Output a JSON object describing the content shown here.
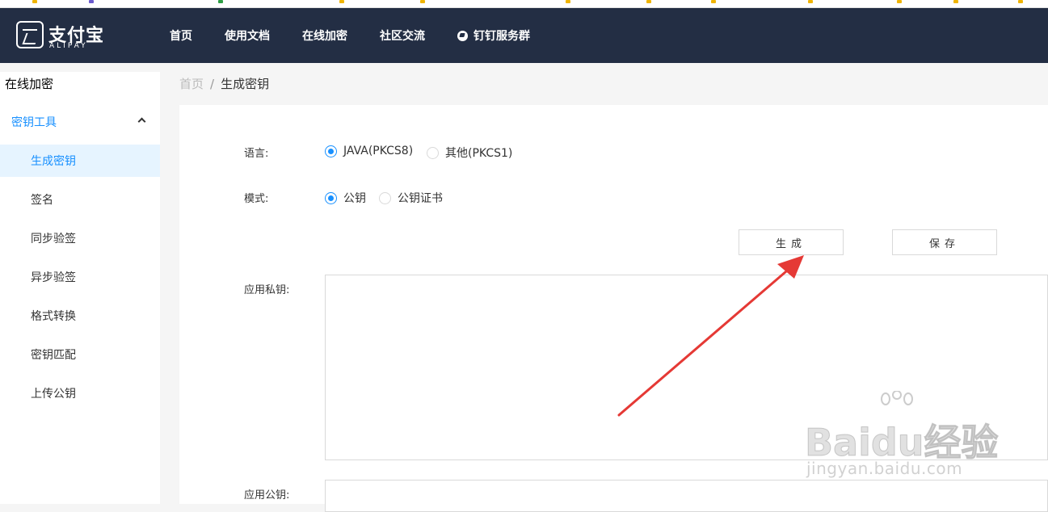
{
  "brand": {
    "name_cn": "支付宝",
    "name_en": "ALIPAY"
  },
  "nav": [
    "首页",
    "使用文档",
    "在线加密",
    "社区交流",
    "钉钉服务群"
  ],
  "sidebar": {
    "title": "在线加密",
    "submenu_label": "密钥工具",
    "items": [
      "生成密钥",
      "签名",
      "同步验签",
      "异步验签",
      "格式转换",
      "密钥匹配",
      "上传公钥"
    ],
    "active_index": 0
  },
  "breadcrumb": {
    "home": "首页",
    "sep": "/",
    "current": "生成密钥"
  },
  "form": {
    "language_label": "语言:",
    "language_options": [
      "JAVA(PKCS8)",
      "其他(PKCS1)"
    ],
    "language_selected": "JAVA(PKCS8)",
    "mode_label": "模式:",
    "mode_options": [
      "公钥",
      "公钥证书"
    ],
    "mode_selected": "公钥",
    "generate_button": "生成",
    "save_button": "保存",
    "private_key_label": "应用私钥:",
    "private_key_value": "",
    "public_key_label": "应用公钥:",
    "public_key_value": ""
  },
  "watermark": {
    "brand": "Baidu经验",
    "url": "jingyan.baidu.com"
  },
  "colors": {
    "header_bg": "#232e44",
    "accent": "#1890ff",
    "annotation_arrow": "#e53935"
  }
}
